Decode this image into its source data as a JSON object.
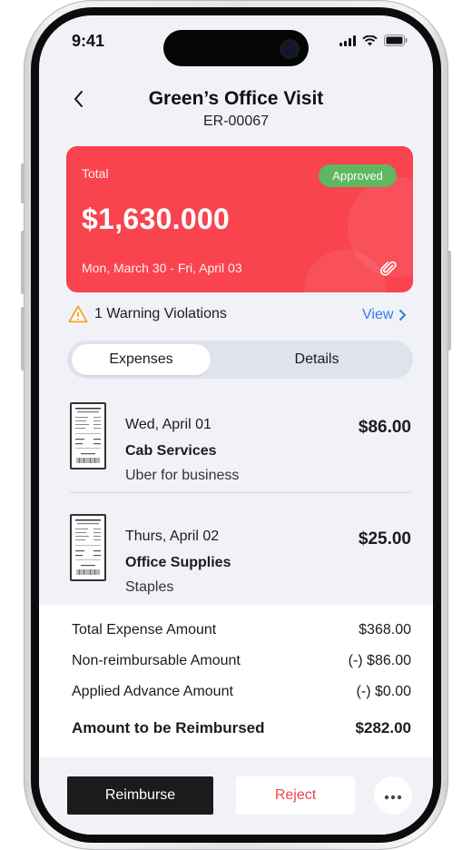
{
  "status_bar": {
    "time": "9:41"
  },
  "header": {
    "title": "Green’s Office Visit",
    "report_id": "ER-00067"
  },
  "summary_card": {
    "total_label": "Total",
    "total_amount": "$1,630.000",
    "status": "Approved",
    "date_range": "Mon, March 30 - Fri, April 03",
    "colors": {
      "card": "#f9434f",
      "status": "#5fb75f"
    }
  },
  "warning": {
    "text": "1 Warning Violations",
    "link_label": "View"
  },
  "tabs": [
    {
      "label": "Expenses",
      "active": true
    },
    {
      "label": "Details",
      "active": false
    }
  ],
  "expenses": [
    {
      "date": "Wed, April 01",
      "category": "Cab Services",
      "vendor": "Uber for business",
      "amount": "$86.00",
      "icon": "receipt-icon"
    },
    {
      "date": "Thurs, April 02",
      "category": "Office Supplies",
      "vendor": "Staples",
      "amount": "$25.00",
      "icon": "receipt-icon"
    }
  ],
  "totals": [
    {
      "label": "Total Expense Amount",
      "value": "$368.00"
    },
    {
      "label": "Non-reimbursable Amount",
      "value": "(-) $86.00"
    },
    {
      "label": "Applied Advance Amount",
      "value": "(-) $0.00"
    },
    {
      "label": "Amount to be Reimbursed",
      "value": "$282.00"
    }
  ],
  "actions": {
    "primary": "Reimburse",
    "secondary": "Reject",
    "more_icon": "ellipsis-icon"
  }
}
